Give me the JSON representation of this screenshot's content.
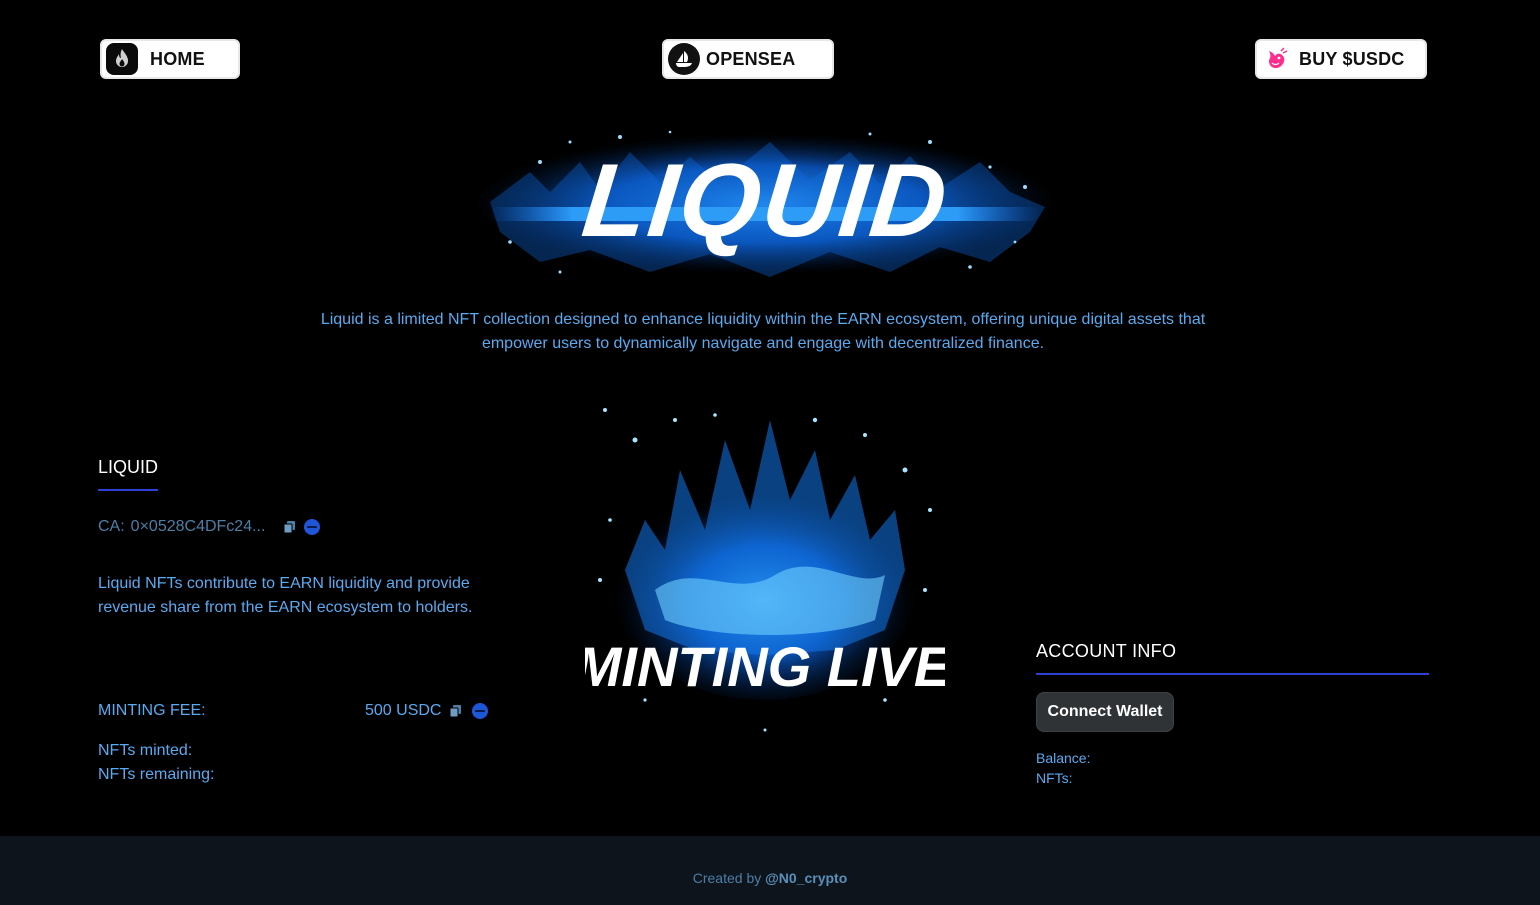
{
  "nav": {
    "home_label": "HOME",
    "opensea_label": "OPENSEA",
    "buy_label": "BUY $USDC"
  },
  "hero": {
    "title": "LIQUID"
  },
  "description": "Liquid is a limited NFT collection designed to enhance liquidity within the EARN ecosystem, offering unique digital assets that empower users to dynamically navigate and engage with decentralized finance.",
  "collection": {
    "title": "LIQUID",
    "ca_label": "CA:",
    "ca_value": "0×0528C4DFc24...",
    "blurb": "Liquid NFTs contribute to EARN liquidity and provide revenue share from the EARN ecosystem to holders.",
    "fee_label": "MINTING FEE:",
    "fee_value": "500 USDC",
    "minted_label": "NFTs minted:",
    "remaining_label": "NFTs remaining:"
  },
  "mint_art": {
    "caption": "MINTING LIVE"
  },
  "account": {
    "title": "ACCOUNT INFO",
    "connect_label": "Connect Wallet",
    "balance_label": "Balance:",
    "nfts_label": "NFTs:"
  },
  "footer": {
    "prefix": "Created by ",
    "handle": "@N0_crypto"
  },
  "colors": {
    "accent_text": "#5aaaf0",
    "underline": "#2e3fd6",
    "footer_bg": "#0d141c"
  },
  "icons": [
    "flame-icon",
    "opensea-icon",
    "uniswap-icon",
    "copy-icon",
    "chain-icon"
  ]
}
